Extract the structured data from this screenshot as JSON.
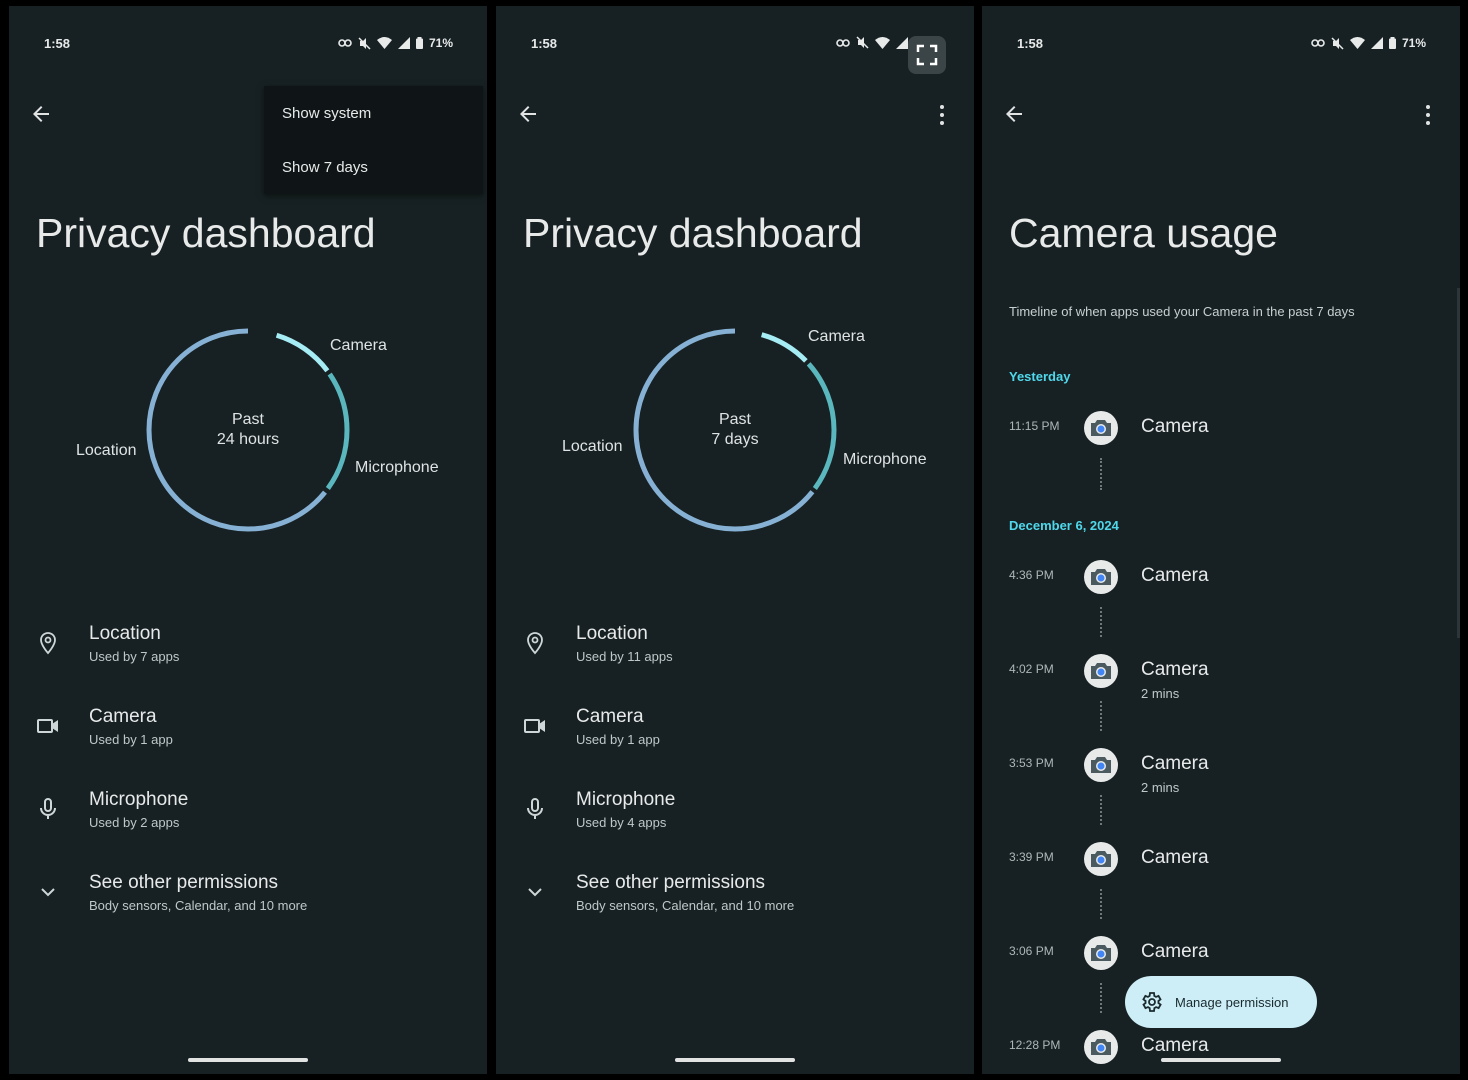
{
  "status": {
    "time": "1:58",
    "battery": "71%"
  },
  "colors": {
    "background": "#172123",
    "accent": "#4fd8eb",
    "ring_blue": "#86b1d4",
    "ring_teal": "#5ab7bd",
    "ring_light": "#a6ecf5"
  },
  "screen1": {
    "menu": {
      "items": [
        "Show system",
        "Show 7 days"
      ]
    },
    "title": "Privacy dashboard",
    "ring": {
      "center_line1": "Past",
      "center_line2": "24 hours",
      "labels": {
        "camera": "Camera",
        "location": "Location",
        "microphone": "Microphone"
      }
    },
    "permissions": [
      {
        "title": "Location",
        "subtitle": "Used by 7 apps"
      },
      {
        "title": "Camera",
        "subtitle": "Used by 1 app"
      },
      {
        "title": "Microphone",
        "subtitle": "Used by 2 apps"
      },
      {
        "title": "See other permissions",
        "subtitle": "Body sensors, Calendar, and 10 more"
      }
    ]
  },
  "screen2": {
    "title": "Privacy dashboard",
    "ring": {
      "center_line1": "Past",
      "center_line2": "7 days",
      "labels": {
        "camera": "Camera",
        "location": "Location",
        "microphone": "Microphone"
      }
    },
    "permissions": [
      {
        "title": "Location",
        "subtitle": "Used by 11 apps"
      },
      {
        "title": "Camera",
        "subtitle": "Used by 1 app"
      },
      {
        "title": "Microphone",
        "subtitle": "Used by 4 apps"
      },
      {
        "title": "See other permissions",
        "subtitle": "Body sensors, Calendar, and 10 more"
      }
    ]
  },
  "screen3": {
    "title": "Camera usage",
    "subtitle": "Timeline of when apps used your Camera in the past 7 days",
    "groups": [
      {
        "header": "Yesterday",
        "entries": [
          {
            "time": "11:15 PM",
            "name": "Camera",
            "duration": ""
          }
        ]
      },
      {
        "header": "December 6, 2024",
        "entries": [
          {
            "time": "4:36 PM",
            "name": "Camera",
            "duration": ""
          },
          {
            "time": "4:02 PM",
            "name": "Camera",
            "duration": "2 mins"
          },
          {
            "time": "3:53 PM",
            "name": "Camera",
            "duration": "2 mins"
          },
          {
            "time": "3:39 PM",
            "name": "Camera",
            "duration": ""
          },
          {
            "time": "3:06 PM",
            "name": "Camera",
            "duration": ""
          },
          {
            "time": "12:28 PM",
            "name": "Camera",
            "duration": ""
          }
        ]
      }
    ],
    "fab_label": "Manage permission"
  }
}
